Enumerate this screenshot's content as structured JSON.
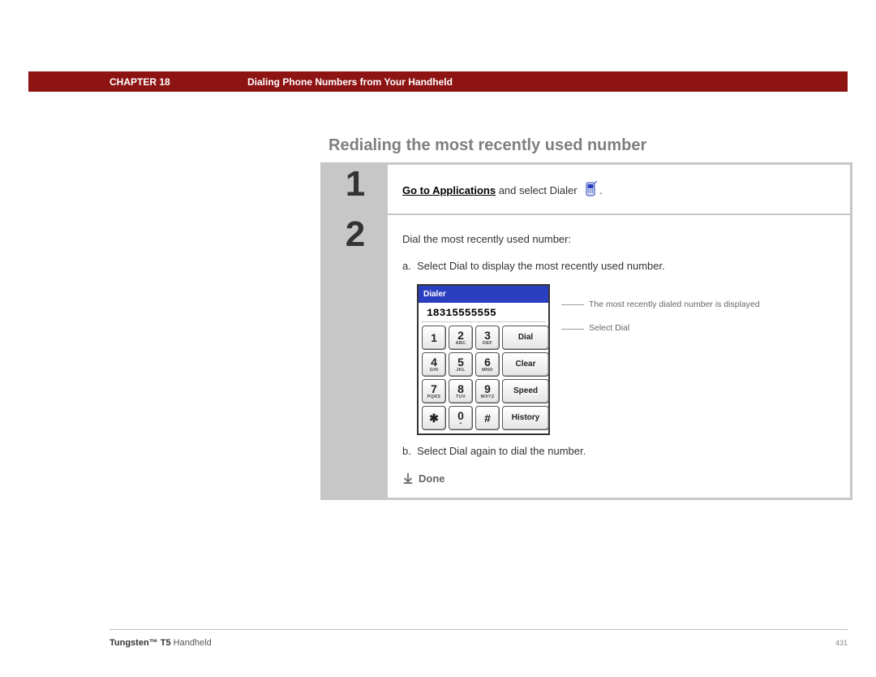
{
  "header": {
    "chapter_label": "CHAPTER 18",
    "chapter_title": "Dialing Phone Numbers from Your Handheld"
  },
  "section_heading": "Redialing the most recently used number",
  "steps": {
    "s1": {
      "num": "1",
      "link_text": "Go to Applications",
      "rest_text": " and select Dialer ",
      "tail_text": "."
    },
    "s2": {
      "num": "2",
      "intro": "Dial the most recently used number:",
      "a_label": "a.",
      "a_text": "Select Dial to display the most recently used number.",
      "b_label": "b.",
      "b_text": "Select Dial again to dial the number.",
      "done": "Done"
    }
  },
  "dialer": {
    "title": "Dialer",
    "number": "18315555555",
    "keys": {
      "k1": {
        "d": "1",
        "sub": ""
      },
      "k2": {
        "d": "2",
        "sub": "ABC"
      },
      "k3": {
        "d": "3",
        "sub": "DEF"
      },
      "k4": {
        "d": "4",
        "sub": "GHI"
      },
      "k5": {
        "d": "5",
        "sub": "JKL"
      },
      "k6": {
        "d": "6",
        "sub": "MNO"
      },
      "k7": {
        "d": "7",
        "sub": "PQRS"
      },
      "k8": {
        "d": "8",
        "sub": "TUV"
      },
      "k9": {
        "d": "9",
        "sub": "WXYZ"
      },
      "kstar": {
        "d": "✱",
        "sub": ""
      },
      "k0": {
        "d": "0",
        "sub": "+"
      },
      "khash": {
        "d": "#",
        "sub": ""
      }
    },
    "actions": {
      "dial": "Dial",
      "clear": "Clear",
      "speed": "Speed",
      "history": "History"
    }
  },
  "callouts": {
    "c1": "The most recently dialed number is displayed",
    "c2": "Select Dial"
  },
  "footer": {
    "product_bold": "Tungsten™ T5",
    "product_rest": " Handheld",
    "page": "431"
  }
}
